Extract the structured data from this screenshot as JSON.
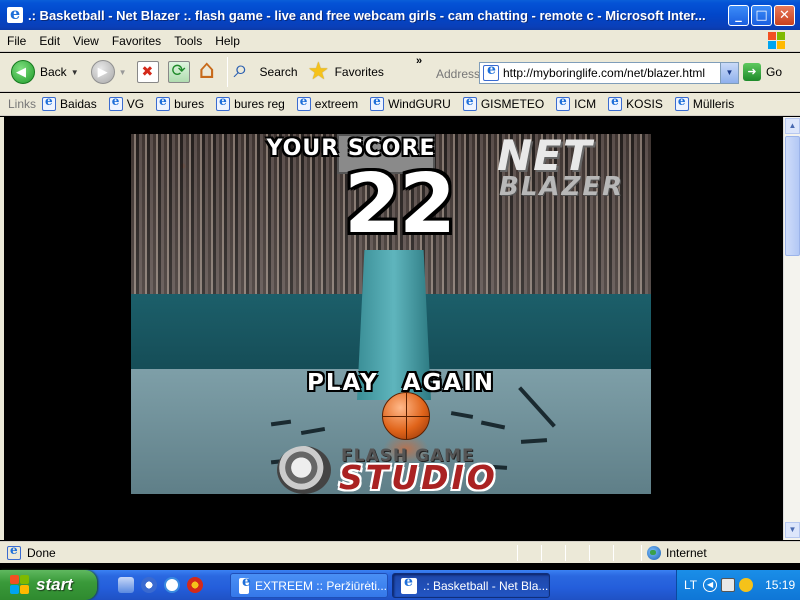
{
  "window": {
    "title": ".: Basketball - Net Blazer :. flash game - live and free webcam girls - cam chatting - remote c - Microsoft Inter...",
    "minimize": "_",
    "maximize": "□",
    "close": "✕"
  },
  "menu": {
    "items": [
      {
        "label": "File"
      },
      {
        "label": "Edit"
      },
      {
        "label": "View"
      },
      {
        "label": "Favorites"
      },
      {
        "label": "Tools"
      },
      {
        "label": "Help"
      }
    ]
  },
  "toolbar": {
    "back_label": "Back",
    "search_label": "Search",
    "favorites_label": "Favorites",
    "overflow": "»"
  },
  "address": {
    "label": "Address",
    "url": "http://myboringlife.com/net/blazer.html",
    "go_label": "Go"
  },
  "links": {
    "label": "Links",
    "items": [
      {
        "label": "Baidas"
      },
      {
        "label": "VG"
      },
      {
        "label": "bures"
      },
      {
        "label": "bures reg"
      },
      {
        "label": "extreem"
      },
      {
        "label": "WindGURU"
      },
      {
        "label": "GISMETEO"
      },
      {
        "label": "ICM"
      },
      {
        "label": "KOSIS"
      },
      {
        "label": "Mülleris"
      }
    ]
  },
  "game": {
    "score_label": "YOUR SCORE",
    "score_value": "22",
    "logo_top": "NET",
    "logo_bottom": "BLAZER",
    "play_again": "PLAY AGAIN",
    "studio_top": "FLASH GAME",
    "studio_main": "STUDIO"
  },
  "status": {
    "text": "Done",
    "zone": "Internet"
  },
  "taskbar": {
    "start_label": "start",
    "tasks": [
      {
        "label": "EXTREEM :: Peržiūrėti..."
      },
      {
        "label": ".: Basketball - Net Bla..."
      }
    ],
    "language": "LT",
    "clock": "15:19"
  },
  "colors": {
    "title_bar": "#0146c9",
    "chrome": "#ece9d8",
    "taskbar": "#245edb",
    "start_button": "#3a9a3a",
    "court_wall": "#1c5f6a",
    "court_floor": "#7e9fa8"
  }
}
